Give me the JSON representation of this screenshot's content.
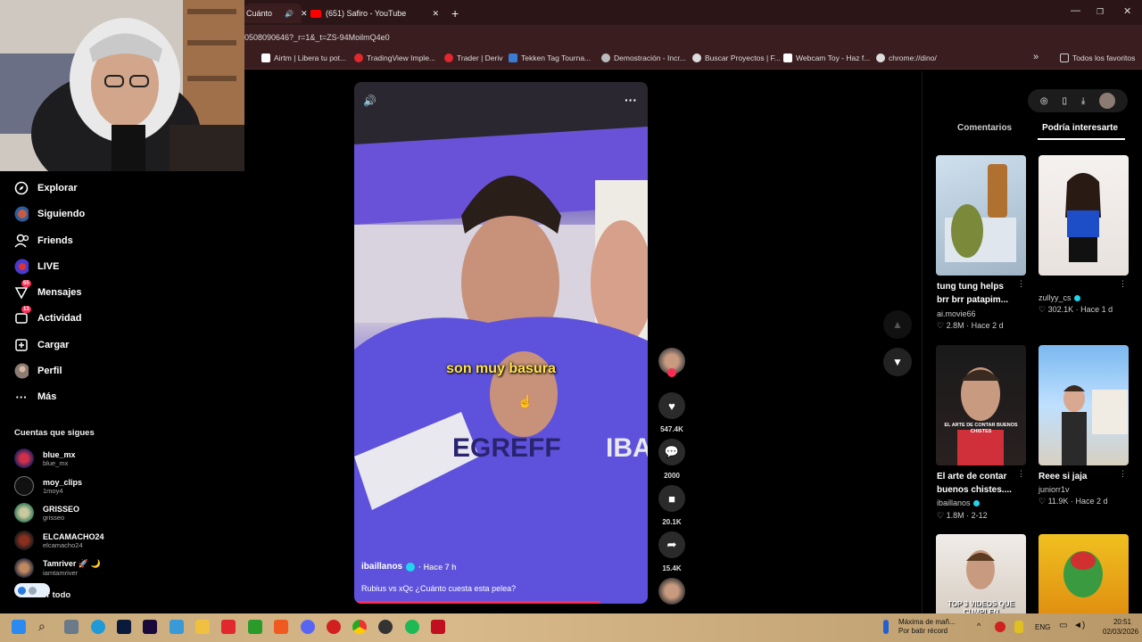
{
  "browser": {
    "tabs": [
      {
        "label": "Cuánto",
        "active": true
      },
      {
        "label": "(651) Safiro - YouTube",
        "active": false
      }
    ],
    "new_tab": "+",
    "url": "0508090646?_r=1&_t=ZS-94MoilmQ4e0",
    "bookmarks": [
      "Airtm | Libera tu pot...",
      "TradingView Imple...",
      "Trader | Deriv",
      "Tekken Tag Tourna...",
      "Demostración - Incr...",
      "Buscar Proyectos | F...",
      "Webcam Toy - Haz f...",
      "chrome://dino/"
    ],
    "bookmarks_more": "»",
    "all_favorites": "Todos los favoritos",
    "extension_badge": "25"
  },
  "sidebar": {
    "nav": [
      {
        "label": "Explorar",
        "icon": "compass-icon"
      },
      {
        "label": "Siguiendo",
        "icon": "following-avatar-icon"
      },
      {
        "label": "Friends",
        "icon": "friends-icon"
      },
      {
        "label": "LIVE",
        "icon": "live-icon"
      },
      {
        "label": "Mensajes",
        "icon": "messages-icon",
        "badge": "55"
      },
      {
        "label": "Actividad",
        "icon": "activity-icon",
        "badge": "13"
      },
      {
        "label": "Cargar",
        "icon": "upload-icon"
      },
      {
        "label": "Perfil",
        "icon": "profile-icon"
      },
      {
        "label": "Más",
        "icon": "more-icon"
      }
    ],
    "following_header": "Cuentas que sigues",
    "following": [
      {
        "name": "blue_mx",
        "handle": "blue_mx"
      },
      {
        "name": "moy_clips",
        "handle": "1moy4"
      },
      {
        "name": "GRISSEO",
        "handle": "grisseo"
      },
      {
        "name": "ELCAMACHO24",
        "handle": "elcamacho24"
      },
      {
        "name": "Tamriver 🚀 🌙",
        "handle": "iamtamriver"
      }
    ],
    "see_all": "er todo"
  },
  "video": {
    "caption": "son muy basura",
    "author": "ibaillanos",
    "time": "· Hace 7 h",
    "description": "Rubius vs xQc ¿Cuánto cuesta esta pelea?",
    "progress": 0.84
  },
  "actions": {
    "likes": "547.4K",
    "comments": "2000",
    "saves": "20.1K",
    "shares": "15.4K"
  },
  "right_panel": {
    "tabs": [
      "Comentarios",
      "Podría interesarte"
    ],
    "active_tab": 1,
    "cards": [
      {
        "title": "tung tung helps brr brr patapim...",
        "author": "ai.movie66",
        "likes": "2.8M",
        "time": "Hace 2 d",
        "verified": false,
        "thumb_text": ""
      },
      {
        "title": "",
        "author": "zullyy_cs",
        "likes": "302.1K",
        "time": "Hace 1 d",
        "verified": true,
        "thumb_text": ""
      },
      {
        "title": "El arte de contar buenos chistes....",
        "author": "ibaillanos",
        "likes": "1.8M",
        "time": "2-12",
        "verified": true,
        "thumb_text": "EL ARTE DE CONTAR BUENOS CHISTES"
      },
      {
        "title": "Reee si jaja",
        "author": "juniorr1v",
        "likes": "11.9K",
        "time": "Hace 2 d",
        "verified": false,
        "thumb_text": ""
      },
      {
        "title": "",
        "author": "",
        "likes": "",
        "time": "",
        "verified": false,
        "thumb_text": "TOP 3 VIDEOS QUE CUMPLEN"
      },
      {
        "title": "",
        "author": "",
        "likes": "",
        "time": "",
        "verified": false,
        "thumb_text": ""
      }
    ]
  },
  "taskbar": {
    "weather_title": "Máxima de mañ...",
    "weather_sub": "Por batir récord",
    "lang": "ENG",
    "time": "20:51",
    "date": "02/03/2026"
  }
}
